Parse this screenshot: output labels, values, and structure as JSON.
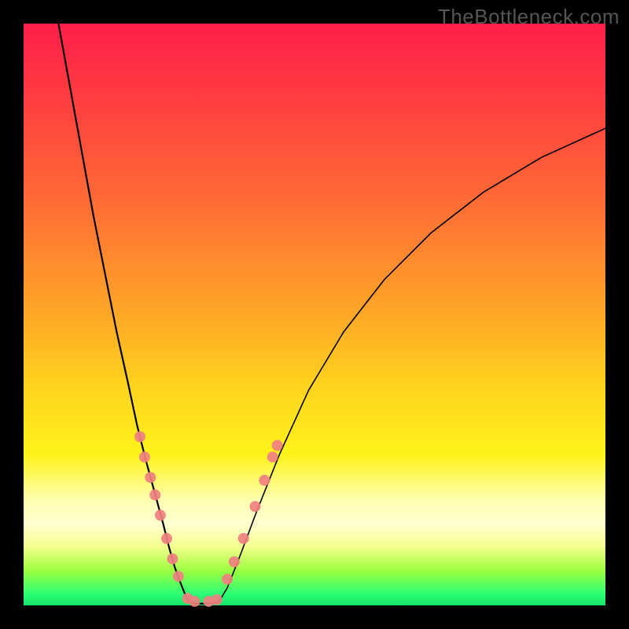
{
  "watermark": "TheBottleneck.com",
  "colors": {
    "frame": "#000000",
    "curve": "#000000",
    "dots": "#f08080",
    "gradient_stops": [
      "#ff1e49",
      "#ff4040",
      "#ff6a36",
      "#ffa128",
      "#ffd21e",
      "#fff31a",
      "#ffffb2",
      "#ffffd0",
      "#f4ff8c",
      "#9cff3e",
      "#2dff77",
      "#15e56a"
    ]
  },
  "chart_data": {
    "type": "line",
    "title": "",
    "xlabel": "",
    "ylabel": "",
    "xlim": [
      0,
      100
    ],
    "ylim": [
      0,
      100
    ],
    "grid": false,
    "legend": false,
    "note": "V-shaped curve on a vertical rainbow gradient; salmon dots cluster along the lower arms of the V. Axis values are not labeled in the image; x/y are normalized 0–100 estimates from pixel positions within the plot area.",
    "series": [
      {
        "name": "left-arm",
        "x": [
          6,
          8,
          10,
          12,
          14,
          16,
          18,
          19.5,
          21,
          22.5,
          24,
          25,
          26,
          27,
          27.8,
          28.5
        ],
        "y": [
          100,
          89,
          78,
          67,
          57,
          47,
          38,
          31,
          25,
          19.5,
          14,
          10,
          6.5,
          3.8,
          1.8,
          0.5
        ]
      },
      {
        "name": "floor",
        "x": [
          28.5,
          30,
          32,
          33.5
        ],
        "y": [
          0.5,
          0.3,
          0.3,
          0.5
        ]
      },
      {
        "name": "right-arm",
        "x": [
          33.5,
          35,
          37,
          40,
          44,
          49,
          55,
          62,
          70,
          79,
          89,
          100
        ],
        "y": [
          0.5,
          3,
          8,
          16,
          26,
          37,
          47,
          56,
          64,
          71,
          77,
          82
        ]
      }
    ],
    "scatter": {
      "name": "dots",
      "points": [
        {
          "x": 20.0,
          "y": 29.0,
          "r": 7
        },
        {
          "x": 20.8,
          "y": 25.5,
          "r": 7
        },
        {
          "x": 21.8,
          "y": 22.0,
          "r": 7
        },
        {
          "x": 22.6,
          "y": 19.0,
          "r": 7
        },
        {
          "x": 23.5,
          "y": 15.5,
          "r": 7
        },
        {
          "x": 24.6,
          "y": 11.5,
          "r": 7
        },
        {
          "x": 25.6,
          "y": 8.0,
          "r": 7
        },
        {
          "x": 26.6,
          "y": 5.0,
          "r": 7
        },
        {
          "x": 28.2,
          "y": 1.2,
          "r": 7
        },
        {
          "x": 29.4,
          "y": 0.7,
          "r": 7
        },
        {
          "x": 31.8,
          "y": 0.7,
          "r": 7
        },
        {
          "x": 33.2,
          "y": 1.0,
          "r": 7
        },
        {
          "x": 35.0,
          "y": 4.5,
          "r": 7
        },
        {
          "x": 36.2,
          "y": 7.5,
          "r": 7
        },
        {
          "x": 37.8,
          "y": 11.5,
          "r": 7
        },
        {
          "x": 39.8,
          "y": 17.0,
          "r": 7
        },
        {
          "x": 41.4,
          "y": 21.5,
          "r": 7
        },
        {
          "x": 42.8,
          "y": 25.5,
          "r": 7
        },
        {
          "x": 43.6,
          "y": 27.5,
          "r": 7
        }
      ]
    }
  }
}
